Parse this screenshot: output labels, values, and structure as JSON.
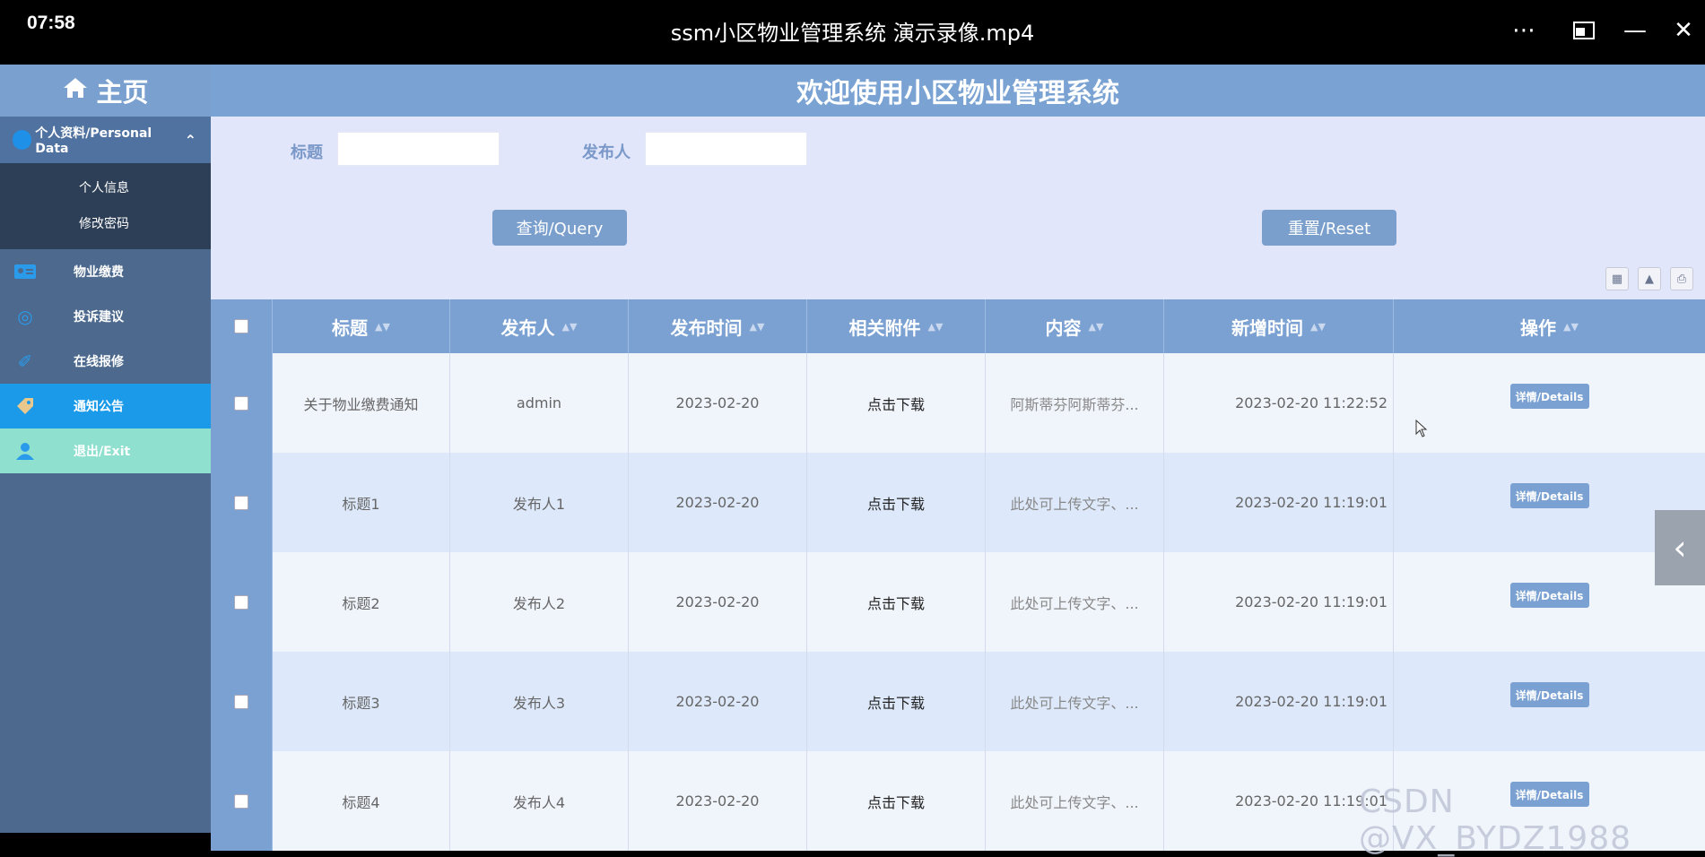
{
  "player": {
    "clock": "07:58",
    "title": "ssm小区物业管理系统 演示录像.mp4"
  },
  "sidebar": {
    "home_label": "主页",
    "group_label": "个人资料/Personal Data",
    "sub_items": [
      "个人信息",
      "修改密码"
    ],
    "items": [
      "物业缴费",
      "投诉建议",
      "在线报修",
      "通知公告",
      "退出/Exit"
    ]
  },
  "header": {
    "title": "欢迎使用小区物业管理系统"
  },
  "search": {
    "title_label": "标题",
    "title_value": "",
    "publisher_label": "发布人",
    "publisher_value": "",
    "query_button": "查询/Query",
    "reset_button": "重置/Reset"
  },
  "table": {
    "columns": [
      "标题",
      "发布人",
      "发布时间",
      "相关附件",
      "内容",
      "新增时间",
      "操作"
    ],
    "rows": [
      {
        "title": "关于物业缴费通知",
        "publisher": "admin",
        "date": "2023-02-20",
        "attachment": "点击下载",
        "content": "阿斯蒂芬阿斯蒂芬...",
        "created": "2023-02-20 11:22:52",
        "action": "详情/Details"
      },
      {
        "title": "标题1",
        "publisher": "发布人1",
        "date": "2023-02-20",
        "attachment": "点击下载",
        "content": "此处可上传文字、...",
        "created": "2023-02-20 11:19:01",
        "action": "详情/Details"
      },
      {
        "title": "标题2",
        "publisher": "发布人2",
        "date": "2023-02-20",
        "attachment": "点击下载",
        "content": "此处可上传文字、...",
        "created": "2023-02-20 11:19:01",
        "action": "详情/Details"
      },
      {
        "title": "标题3",
        "publisher": "发布人3",
        "date": "2023-02-20",
        "attachment": "点击下载",
        "content": "此处可上传文字、...",
        "created": "2023-02-20 11:19:01",
        "action": "详情/Details"
      },
      {
        "title": "标题4",
        "publisher": "发布人4",
        "date": "2023-02-20",
        "attachment": "点击下载",
        "content": "此处可上传文字、...",
        "created": "2023-02-20 11:19:01",
        "action": "详情/Details"
      }
    ]
  },
  "watermark": "CSDN @VX_BYDZ1988",
  "colors": {
    "header_blue": "#7aa3d3",
    "active_nav": "#1a9ae9",
    "exit_nav": "#8fe0cf",
    "sidebar_bg": "#4d6a8e"
  }
}
